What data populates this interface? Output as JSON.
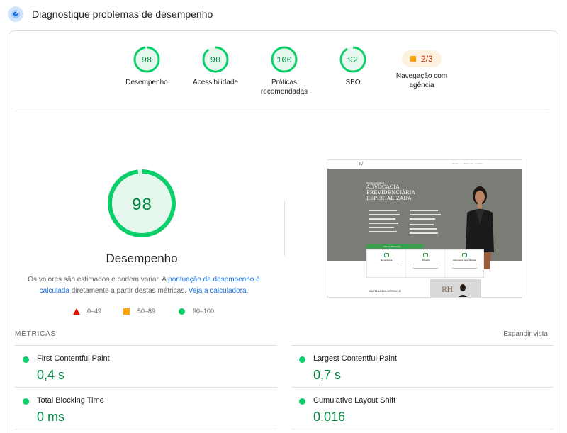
{
  "header": {
    "title": "Diagnostique problemas de desempenho",
    "icon": "lighthouse-diagnostic-icon"
  },
  "gauges": [
    {
      "score": "98",
      "label": "Desempenho",
      "value": 98
    },
    {
      "score": "90",
      "label": "Acessibilidade",
      "value": 90
    },
    {
      "score": "100",
      "label_line1": "Práticas",
      "label_line2": "recomendadas",
      "value": 100
    },
    {
      "score": "92",
      "label": "SEO",
      "value": 92
    }
  ],
  "navigation": {
    "badge": "2/3",
    "label_line1": "Navegação com",
    "label_line2": "agência"
  },
  "main": {
    "score": "98",
    "score_value": 98,
    "label": "Desempenho",
    "note_prefix": "Os valores são estimados e podem variar. A ",
    "note_link1": "pontuação de desempenho é calculada",
    "note_middle": " diretamente a partir destas métricas. ",
    "note_link2": "Veja a calculadora."
  },
  "legend": {
    "poor": "0–49",
    "average": "50–89",
    "good": "90–100"
  },
  "screenshot": {
    "logo": "R/",
    "menu": [
      "Home",
      "Sobre nós",
      "Contato"
    ],
    "eyebrow": "Escritório Perfilado",
    "headline_l1": "ADVOCACIA",
    "headline_l2": "PREVIDENCIÁRIA",
    "headline_l3": "ESPECIALIZADA",
    "button": "Fale no WhatsApp",
    "cards": [
      "Experiência",
      "Eficácia",
      "Advocacia Especializada"
    ],
    "name": "RAYMANDA HUDSON"
  },
  "metrics": {
    "title": "MÉTRICAS",
    "expand": "Expandir vista",
    "items": [
      {
        "name": "First Contentful Paint",
        "value": "0,4 s"
      },
      {
        "name": "Largest Contentful Paint",
        "value": "0,7 s"
      },
      {
        "name": "Total Blocking Time",
        "value": "0 ms"
      },
      {
        "name": "Cumulative Layout Shift",
        "value": "0.016"
      }
    ]
  },
  "colors": {
    "good": "#0cce6b",
    "good_text": "#018642",
    "good_fill": "#e6f8ee",
    "average": "#ffa400",
    "poor": "#eb0f00",
    "link": "#1a73e8"
  }
}
